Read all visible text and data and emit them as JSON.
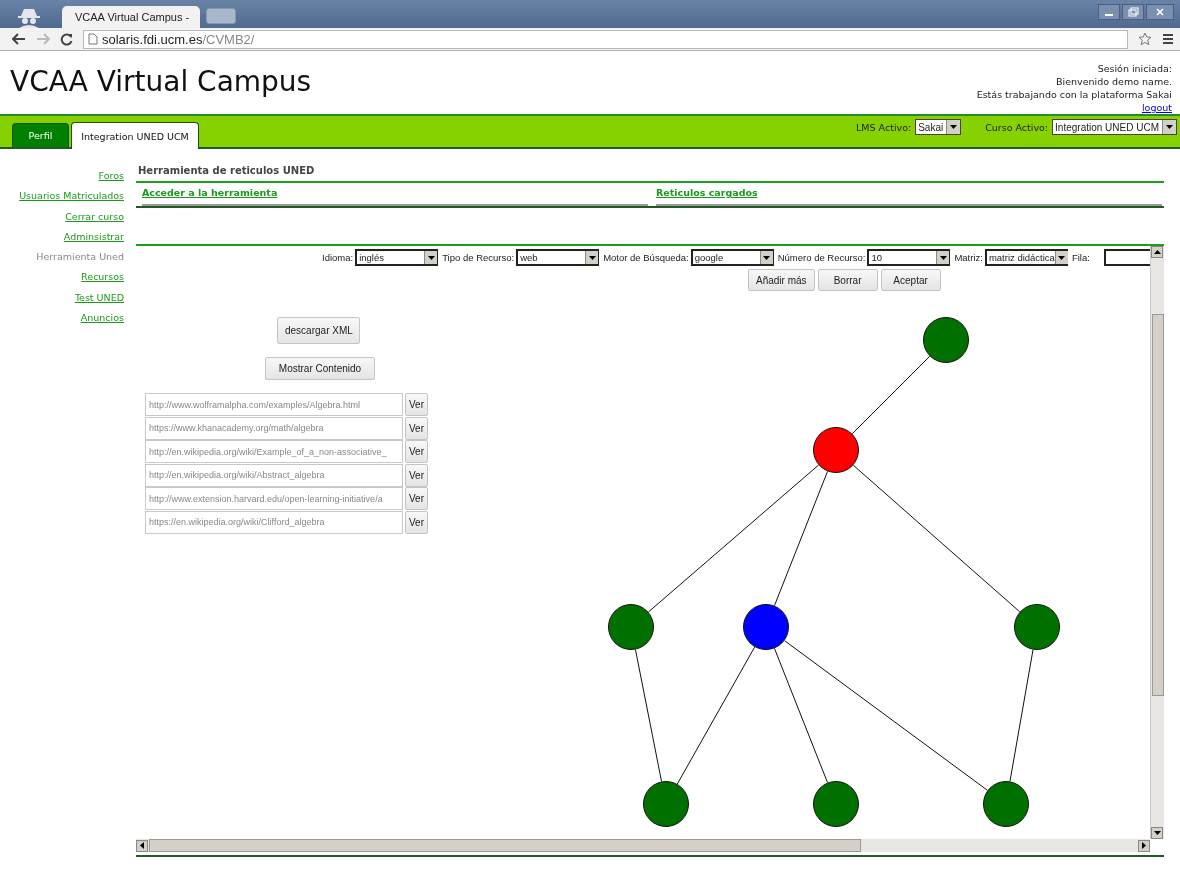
{
  "browser": {
    "tab_title": "VCAA Virtual Campus -",
    "url_host": "solaris.fdi.ucm.es",
    "url_path": "/CVMB2/"
  },
  "header": {
    "title": "VCAA Virtual Campus",
    "session_lines": [
      "Sesión iniciada:",
      "Bienvenido demo name.",
      "Estás trabajando con la plataforma Sakai"
    ],
    "logout": "logout"
  },
  "nav": {
    "tabs": [
      {
        "label": "Perfil",
        "selected": false
      },
      {
        "label": "Integration UNED UCM",
        "selected": true
      }
    ],
    "lms": {
      "label": "LMS Activo:",
      "value": "Sakai"
    },
    "course": {
      "label": "Curso Activo:",
      "value": "Integration UNED UCM"
    }
  },
  "sidebar": {
    "items": [
      {
        "label": "Foros",
        "selected": false
      },
      {
        "label": "Usuarios Matriculados",
        "selected": false
      },
      {
        "label": "Cerrar curso",
        "selected": false
      },
      {
        "label": "Adminsistrar",
        "selected": false
      },
      {
        "label": "Herramienta Uned",
        "selected": true
      },
      {
        "label": "Recursos",
        "selected": false
      },
      {
        "label": "Test UNED",
        "selected": false
      },
      {
        "label": "Anuncios",
        "selected": false
      }
    ]
  },
  "tool": {
    "title": "Herramienta de reticulos UNED",
    "links": [
      "Acceder a la herramienta",
      "Reticulos cargados"
    ],
    "filters": [
      {
        "label": "Idioma:",
        "value": "inglés"
      },
      {
        "label": "Tipo de Recurso:",
        "value": "web"
      },
      {
        "label": "Motor de Búsqueda:",
        "value": "google"
      },
      {
        "label": "Número de Recurso:",
        "value": "10"
      },
      {
        "label": "Matriz:",
        "value": "matriz didáctica"
      },
      {
        "label": "Fila:"
      }
    ],
    "actions": [
      "Añadir más",
      "Borrar",
      "Aceptar"
    ],
    "download": "descargar XML",
    "show": "Mostrar Contenido",
    "resources": [
      {
        "url": "http://www.wolframalpha.com/examples/Algebra.html",
        "button": "Ver"
      },
      {
        "url": "https://www.khanacademy.org/math/algebra",
        "button": "Ver"
      },
      {
        "url": "http://en.wikipedia.org/wiki/Example_of_a_non-associative_",
        "button": "Ver"
      },
      {
        "url": "http://en.wikipedia.org/wiki/Abstract_algebra",
        "button": "Ver"
      },
      {
        "url": "http://www.extension.harvard.edu/open-learning-initiative/a",
        "button": "Ver"
      },
      {
        "url": "https://en.wikipedia.org/wiki/Clifford_algebra",
        "button": "Ver"
      }
    ],
    "lattice": {
      "nodes": [
        {
          "color": "#007000"
        },
        {
          "color": "#ff0000"
        },
        {
          "color": "#007000"
        },
        {
          "color": "#0000ff"
        },
        {
          "color": "#007000"
        },
        {
          "color": "#007000"
        },
        {
          "color": "#007000"
        },
        {
          "color": "#007000"
        }
      ]
    }
  }
}
